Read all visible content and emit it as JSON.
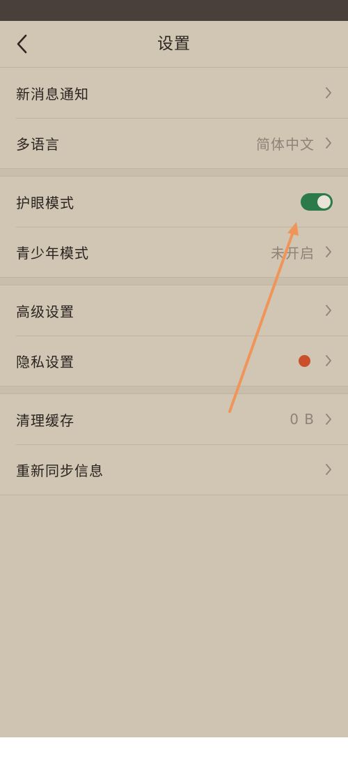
{
  "nav": {
    "title": "设置",
    "back_icon": "chevron-left-icon"
  },
  "groups": [
    {
      "items": [
        {
          "label": "新消息通知",
          "value": "",
          "control": "chevron"
        },
        {
          "label": "多语言",
          "value": "简体中文",
          "control": "chevron"
        }
      ]
    },
    {
      "items": [
        {
          "label": "护眼模式",
          "value": "",
          "control": "toggle",
          "toggle_on": true
        },
        {
          "label": "青少年模式",
          "value": "未开启",
          "control": "chevron"
        }
      ]
    },
    {
      "items": [
        {
          "label": "高级设置",
          "value": "",
          "control": "chevron"
        },
        {
          "label": "隐私设置",
          "value": "",
          "control": "chevron",
          "badge": "red-dot"
        }
      ]
    },
    {
      "items": [
        {
          "label": "清理缓存",
          "value": "0 B",
          "control": "chevron"
        },
        {
          "label": "重新同步信息",
          "value": "",
          "control": "chevron"
        }
      ]
    }
  ],
  "colors": {
    "background": "#cfc3b2",
    "status_bar": "#4a403b",
    "toggle_on": "#2a7a4a",
    "badge_dot": "#c9502a",
    "annotation_arrow": "#f0955a"
  }
}
